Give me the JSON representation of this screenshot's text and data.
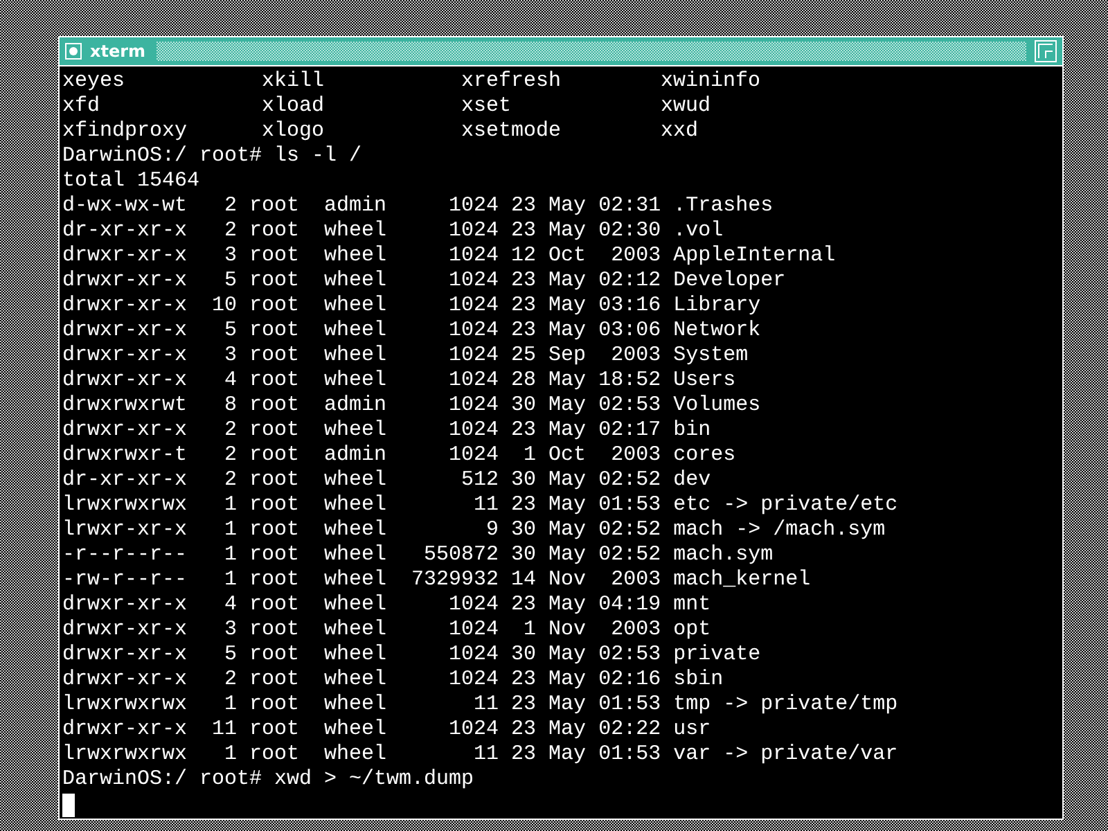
{
  "window": {
    "title": "xterm"
  },
  "command_grid": [
    [
      "xeyes",
      "xkill",
      "xrefresh",
      "xwininfo"
    ],
    [
      "xfd",
      "xload",
      "xset",
      "xwud"
    ],
    [
      "xfindproxy",
      "xlogo",
      "xsetmode",
      "xxd"
    ]
  ],
  "lines": [
    "DarwinOS:/ root# ls -l /",
    "total 15464",
    "d-wx-wx-wt   2 root  admin     1024 23 May 02:31 .Trashes",
    "dr-xr-xr-x   2 root  wheel     1024 23 May 02:30 .vol",
    "drwxr-xr-x   3 root  wheel     1024 12 Oct  2003 AppleInternal",
    "drwxr-xr-x   5 root  wheel     1024 23 May 02:12 Developer",
    "drwxr-xr-x  10 root  wheel     1024 23 May 03:16 Library",
    "drwxr-xr-x   5 root  wheel     1024 23 May 03:06 Network",
    "drwxr-xr-x   3 root  wheel     1024 25 Sep  2003 System",
    "drwxr-xr-x   4 root  wheel     1024 28 May 18:52 Users",
    "drwxrwxrwt   8 root  admin     1024 30 May 02:53 Volumes",
    "drwxr-xr-x   2 root  wheel     1024 23 May 02:17 bin",
    "drwxrwxr-t   2 root  admin     1024  1 Oct  2003 cores",
    "dr-xr-xr-x   2 root  wheel      512 30 May 02:52 dev",
    "lrwxrwxrwx   1 root  wheel       11 23 May 01:53 etc -> private/etc",
    "lrwxr-xr-x   1 root  wheel        9 30 May 02:52 mach -> /mach.sym",
    "-r--r--r--   1 root  wheel   550872 30 May 02:52 mach.sym",
    "-rw-r--r--   1 root  wheel  7329932 14 Nov  2003 mach_kernel",
    "drwxr-xr-x   4 root  wheel     1024 23 May 04:19 mnt",
    "drwxr-xr-x   3 root  wheel     1024  1 Nov  2003 opt",
    "drwxr-xr-x   5 root  wheel     1024 30 May 02:53 private",
    "drwxr-xr-x   2 root  wheel     1024 23 May 02:16 sbin",
    "lrwxrwxrwx   1 root  wheel       11 23 May 01:53 tmp -> private/tmp",
    "drwxr-xr-x  11 root  wheel     1024 23 May 02:22 usr",
    "lrwxrwxrwx   1 root  wheel       11 23 May 01:53 var -> private/var",
    "DarwinOS:/ root# xwd > ~/twm.dump"
  ],
  "cursor_visible": true
}
